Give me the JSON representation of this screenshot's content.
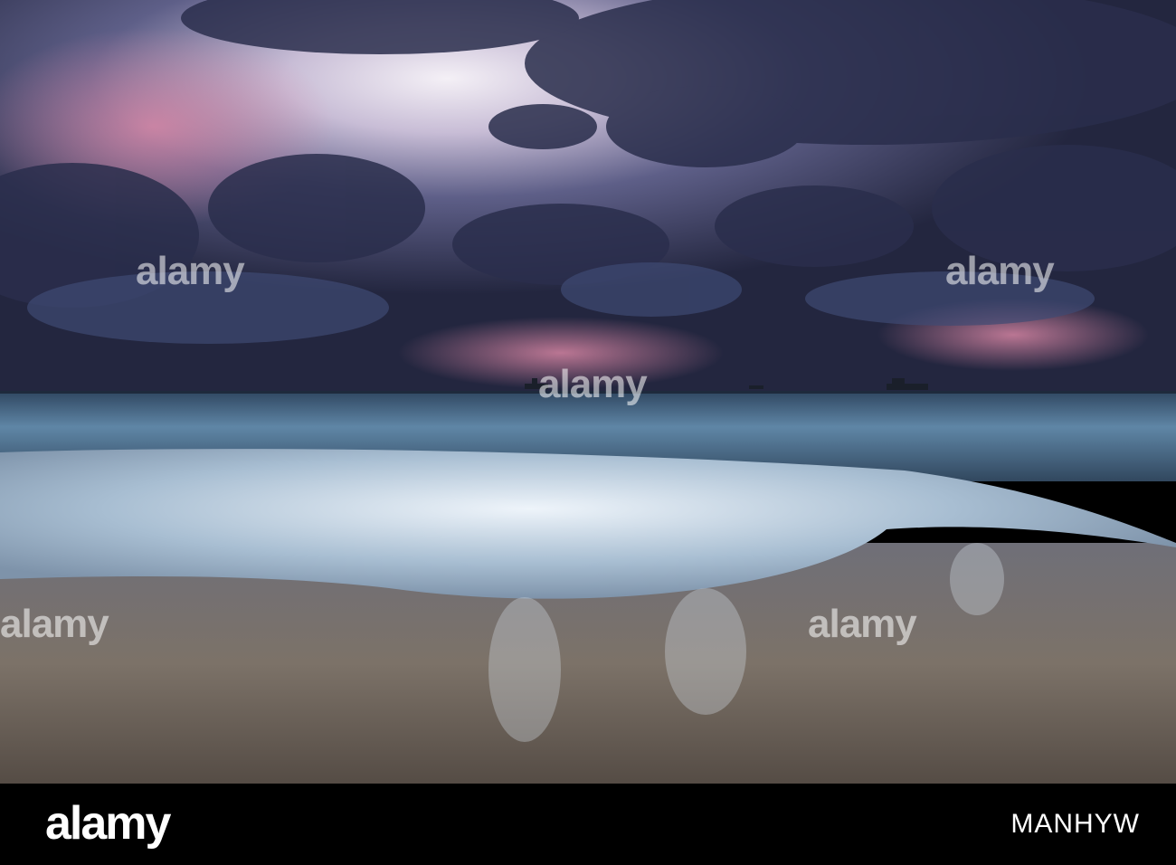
{
  "watermark": {
    "text": "alamy",
    "positions_count": 12
  },
  "footer": {
    "logo": "alamy",
    "image_id": "MANHYW",
    "background_color": "#000000",
    "text_color": "#ffffff"
  },
  "scene": {
    "sky_colors": [
      "#2b2f4e",
      "#6e6a92",
      "#e8e2ee",
      "#c77f9c"
    ],
    "sea_color": "#3c5a78",
    "foam_color": "#dce8f2",
    "sand_color": "#7a7168"
  }
}
